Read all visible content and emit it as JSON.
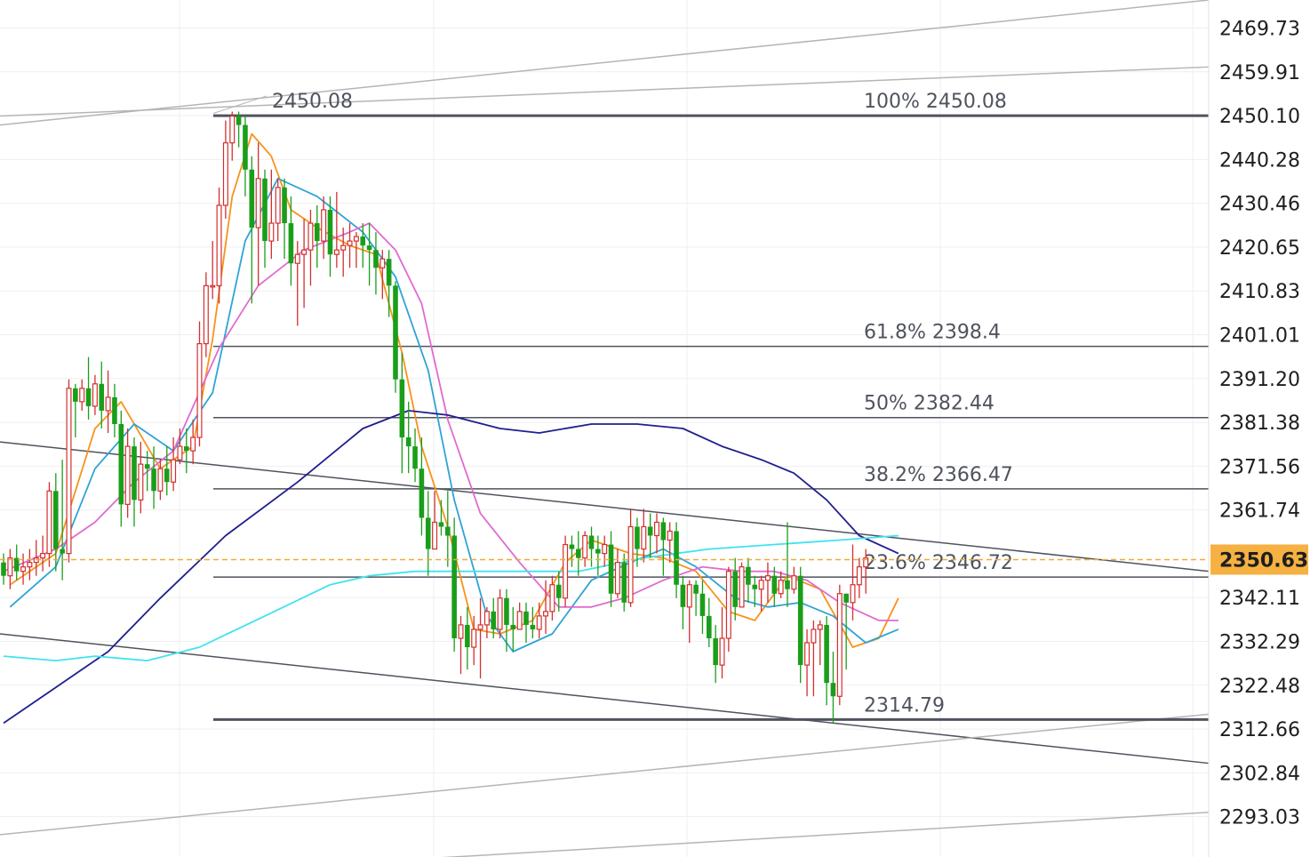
{
  "chart_data": {
    "type": "candlestick",
    "ylim": [
      2284.0,
      2476.0
    ],
    "y_ticks": [
      "2469.73",
      "2459.91",
      "2450.10",
      "2440.28",
      "2430.46",
      "2420.65",
      "2410.83",
      "2401.01",
      "2391.20",
      "2381.38",
      "2371.56",
      "2361.74",
      "2342.11",
      "2332.29",
      "2322.48",
      "2312.66",
      "2302.84",
      "2293.03"
    ],
    "last_price": "2350.63",
    "colors": {
      "up": "#d32f2f",
      "down": "#1a9e1a",
      "fib": "#50535e",
      "ma_orange": "#f7931a",
      "ma_blue": "#2fa4d6",
      "ma_pink": "#e06bd0",
      "ma_navy": "#1f1f8f",
      "ma_cyan": "#3fe3f0",
      "trend": "#50535e",
      "light_trend": "#b5b5b5",
      "current_price": "#f0a93b"
    },
    "fib_levels": [
      {
        "label": "100% 2450.08",
        "price": 2450.08
      },
      {
        "label": "61.8% 2398.4",
        "price": 2398.4
      },
      {
        "label": "50% 2382.44",
        "price": 2382.44
      },
      {
        "label": "38.2% 2366.47",
        "price": 2366.47
      },
      {
        "label": "23.6% 2346.72",
        "price": 2346.72
      },
      {
        "label": "2314.79",
        "price": 2314.79
      }
    ],
    "annotations": [
      {
        "text": "2450.08",
        "price": 2450.08
      }
    ],
    "candles": [
      [
        2350,
        2347,
        2352,
        2345
      ],
      [
        2347,
        2351,
        2353,
        2344
      ],
      [
        2351,
        2348,
        2354,
        2346
      ],
      [
        2348,
        2349,
        2352,
        2345
      ],
      [
        2349,
        2350,
        2353,
        2346
      ],
      [
        2350,
        2351,
        2355,
        2347
      ],
      [
        2351,
        2352,
        2356,
        2348
      ],
      [
        2352,
        2366,
        2368,
        2349
      ],
      [
        2366,
        2353,
        2370,
        2348
      ],
      [
        2353,
        2352,
        2373,
        2346
      ],
      [
        2352,
        2389,
        2391,
        2350
      ],
      [
        2389,
        2386,
        2390,
        2378
      ],
      [
        2386,
        2389,
        2391,
        2384
      ],
      [
        2389,
        2385,
        2396,
        2382
      ],
      [
        2385,
        2390,
        2392,
        2383
      ],
      [
        2390,
        2384,
        2395,
        2380
      ],
      [
        2384,
        2387,
        2393,
        2379
      ],
      [
        2387,
        2381,
        2390,
        2378
      ],
      [
        2381,
        2363,
        2384,
        2358
      ],
      [
        2363,
        2376,
        2380,
        2360
      ],
      [
        2376,
        2364,
        2378,
        2358
      ],
      [
        2364,
        2372,
        2377,
        2361
      ],
      [
        2372,
        2371,
        2375,
        2366
      ],
      [
        2371,
        2366,
        2376,
        2362
      ],
      [
        2366,
        2371,
        2373,
        2364
      ],
      [
        2371,
        2368,
        2376,
        2365
      ],
      [
        2368,
        2373,
        2378,
        2366
      ],
      [
        2373,
        2376,
        2380,
        2372
      ],
      [
        2376,
        2375,
        2380,
        2370
      ],
      [
        2375,
        2378,
        2382,
        2372
      ],
      [
        2378,
        2399,
        2404,
        2376
      ],
      [
        2399,
        2412,
        2415,
        2396
      ],
      [
        2412,
        2412,
        2422,
        2409
      ],
      [
        2412,
        2430,
        2434,
        2408
      ],
      [
        2430,
        2444,
        2449,
        2427
      ],
      [
        2444,
        2450,
        2451,
        2440
      ],
      [
        2450,
        2448,
        2451,
        2443
      ],
      [
        2448,
        2438,
        2450,
        2432
      ],
      [
        2438,
        2425,
        2441,
        2408
      ],
      [
        2425,
        2436,
        2444,
        2412
      ],
      [
        2436,
        2422,
        2438,
        2416
      ],
      [
        2422,
        2426,
        2438,
        2418
      ],
      [
        2426,
        2434,
        2436,
        2422
      ],
      [
        2434,
        2426,
        2436,
        2418
      ],
      [
        2426,
        2417,
        2432,
        2412
      ],
      [
        2417,
        2419,
        2422,
        2403
      ],
      [
        2419,
        2420,
        2427,
        2407
      ],
      [
        2420,
        2426,
        2429,
        2412
      ],
      [
        2426,
        2422,
        2430,
        2416
      ],
      [
        2422,
        2429,
        2432,
        2418
      ],
      [
        2429,
        2419,
        2432,
        2414
      ],
      [
        2419,
        2420,
        2433,
        2416
      ],
      [
        2420,
        2421,
        2425,
        2414
      ],
      [
        2421,
        2422,
        2426,
        2416
      ],
      [
        2422,
        2423,
        2424,
        2416
      ],
      [
        2423,
        2421,
        2426,
        2416
      ],
      [
        2421,
        2420,
        2426,
        2412
      ],
      [
        2420,
        2416,
        2424,
        2410
      ],
      [
        2416,
        2418,
        2420,
        2409
      ],
      [
        2418,
        2412,
        2420,
        2405
      ],
      [
        2412,
        2391,
        2413,
        2388
      ],
      [
        2391,
        2378,
        2397,
        2370
      ],
      [
        2378,
        2376,
        2386,
        2370
      ],
      [
        2376,
        2371,
        2380,
        2368
      ],
      [
        2371,
        2360,
        2378,
        2356
      ],
      [
        2360,
        2353,
        2366,
        2347
      ],
      [
        2353,
        2359,
        2366,
        2356
      ],
      [
        2359,
        2358,
        2364,
        2356
      ],
      [
        2358,
        2356,
        2366,
        2349
      ],
      [
        2356,
        2333,
        2360,
        2330
      ],
      [
        2333,
        2336,
        2338,
        2325
      ],
      [
        2336,
        2331,
        2340,
        2326
      ],
      [
        2331,
        2335,
        2338,
        2327
      ],
      [
        2335,
        2336,
        2342,
        2324
      ],
      [
        2336,
        2339,
        2340,
        2333
      ],
      [
        2339,
        2335,
        2342,
        2333
      ],
      [
        2335,
        2342,
        2344,
        2333
      ],
      [
        2342,
        2336,
        2344,
        2330
      ],
      [
        2336,
        2335,
        2340,
        2330
      ],
      [
        2335,
        2339,
        2341,
        2335
      ],
      [
        2339,
        2336,
        2341,
        2332
      ],
      [
        2336,
        2335,
        2340,
        2333
      ],
      [
        2335,
        2338,
        2341,
        2333
      ],
      [
        2338,
        2339,
        2346,
        2334
      ],
      [
        2339,
        2345,
        2347,
        2337
      ],
      [
        2345,
        2342,
        2348,
        2339
      ],
      [
        2342,
        2354,
        2356,
        2340
      ],
      [
        2354,
        2353,
        2356,
        2349
      ],
      [
        2353,
        2351,
        2357,
        2347
      ],
      [
        2351,
        2356,
        2357,
        2349
      ],
      [
        2356,
        2353,
        2358,
        2349
      ],
      [
        2353,
        2352,
        2356,
        2347
      ],
      [
        2352,
        2354,
        2356,
        2349
      ],
      [
        2354,
        2343,
        2357,
        2340
      ],
      [
        2343,
        2350,
        2353,
        2342
      ],
      [
        2350,
        2341,
        2352,
        2339
      ],
      [
        2341,
        2358,
        2362,
        2340
      ],
      [
        2358,
        2353,
        2360,
        2349
      ],
      [
        2353,
        2358,
        2362,
        2350
      ],
      [
        2358,
        2356,
        2361,
        2351
      ],
      [
        2356,
        2359,
        2361,
        2352
      ],
      [
        2359,
        2355,
        2360,
        2347
      ],
      [
        2355,
        2357,
        2359,
        2350
      ],
      [
        2357,
        2345,
        2359,
        2342
      ],
      [
        2345,
        2340,
        2347,
        2335
      ],
      [
        2340,
        2345,
        2346,
        2332
      ],
      [
        2345,
        2343,
        2346,
        2338
      ],
      [
        2343,
        2338,
        2346,
        2334
      ],
      [
        2338,
        2333,
        2342,
        2331
      ],
      [
        2333,
        2327,
        2336,
        2323
      ],
      [
        2327,
        2333,
        2340,
        2324
      ],
      [
        2333,
        2348,
        2349,
        2330
      ],
      [
        2348,
        2340,
        2351,
        2337
      ],
      [
        2340,
        2349,
        2350,
        2340
      ],
      [
        2349,
        2345,
        2351,
        2341
      ],
      [
        2345,
        2344,
        2347,
        2340
      ],
      [
        2344,
        2346,
        2347,
        2339
      ],
      [
        2346,
        2347,
        2350,
        2341
      ],
      [
        2347,
        2343,
        2349,
        2340
      ],
      [
        2343,
        2346,
        2348,
        2342
      ],
      [
        2346,
        2344,
        2359,
        2340
      ],
      [
        2344,
        2347,
        2349,
        2343
      ],
      [
        2347,
        2327,
        2349,
        2323
      ],
      [
        2327,
        2332,
        2335,
        2320
      ],
      [
        2332,
        2335,
        2337,
        2320
      ],
      [
        2335,
        2336,
        2337,
        2327
      ],
      [
        2336,
        2323,
        2338,
        2318
      ],
      [
        2323,
        2320,
        2330,
        2314
      ],
      [
        2320,
        2343,
        2345,
        2318
      ],
      [
        2343,
        2341,
        2343,
        2326
      ],
      [
        2341,
        2345,
        2354,
        2337
      ],
      [
        2345,
        2349,
        2351,
        2342
      ],
      [
        2349,
        2351,
        2353,
        2343
      ]
    ],
    "moving_averages": [
      {
        "color": "#f7931a",
        "pts": [
          [
            1,
            2345
          ],
          [
            8,
            2352
          ],
          [
            14,
            2380
          ],
          [
            18,
            2386
          ],
          [
            24,
            2371
          ],
          [
            29,
            2376
          ],
          [
            32,
            2400
          ],
          [
            35,
            2432
          ],
          [
            38,
            2446
          ],
          [
            41,
            2441
          ],
          [
            44,
            2429
          ],
          [
            48,
            2425
          ],
          [
            53,
            2421
          ],
          [
            57,
            2419
          ],
          [
            61,
            2397
          ],
          [
            64,
            2376
          ],
          [
            68,
            2358
          ],
          [
            72,
            2335
          ],
          [
            76,
            2334
          ],
          [
            81,
            2337
          ],
          [
            86,
            2350
          ],
          [
            90,
            2355
          ],
          [
            96,
            2352
          ],
          [
            101,
            2351
          ],
          [
            106,
            2348
          ],
          [
            111,
            2339
          ],
          [
            115,
            2337
          ],
          [
            120,
            2347
          ],
          [
            125,
            2344
          ],
          [
            130,
            2331
          ],
          [
            134,
            2333
          ],
          [
            137,
            2342
          ]
        ]
      },
      {
        "color": "#2fa4d6",
        "pts": [
          [
            1,
            2340
          ],
          [
            8,
            2349
          ],
          [
            14,
            2371
          ],
          [
            20,
            2381
          ],
          [
            26,
            2375
          ],
          [
            32,
            2388
          ],
          [
            37,
            2422
          ],
          [
            42,
            2436
          ],
          [
            48,
            2432
          ],
          [
            55,
            2424
          ],
          [
            60,
            2414
          ],
          [
            65,
            2393
          ],
          [
            69,
            2364
          ],
          [
            74,
            2338
          ],
          [
            78,
            2330
          ],
          [
            84,
            2334
          ],
          [
            90,
            2346
          ],
          [
            96,
            2350
          ],
          [
            101,
            2353
          ],
          [
            106,
            2349
          ],
          [
            112,
            2342
          ],
          [
            117,
            2340
          ],
          [
            122,
            2341
          ],
          [
            127,
            2338
          ],
          [
            132,
            2332
          ],
          [
            137,
            2335
          ]
        ]
      },
      {
        "color": "#e06bd0",
        "pts": [
          [
            0,
            2348
          ],
          [
            8,
            2353
          ],
          [
            14,
            2359
          ],
          [
            20,
            2368
          ],
          [
            26,
            2375
          ],
          [
            33,
            2398
          ],
          [
            39,
            2412
          ],
          [
            46,
            2420
          ],
          [
            53,
            2424
          ],
          [
            56,
            2426
          ],
          [
            60,
            2420
          ],
          [
            64,
            2408
          ],
          [
            68,
            2382
          ],
          [
            73,
            2361
          ],
          [
            79,
            2350
          ],
          [
            85,
            2340
          ],
          [
            90,
            2340
          ],
          [
            95,
            2342
          ],
          [
            101,
            2346
          ],
          [
            107,
            2349
          ],
          [
            113,
            2348
          ],
          [
            118,
            2348
          ],
          [
            123,
            2346
          ],
          [
            128,
            2341
          ],
          [
            134,
            2337
          ],
          [
            137,
            2337
          ]
        ]
      },
      {
        "color": "#1f1f8f",
        "pts": [
          [
            0,
            2314
          ],
          [
            8,
            2322
          ],
          [
            16,
            2330
          ],
          [
            24,
            2342
          ],
          [
            34,
            2356
          ],
          [
            45,
            2368
          ],
          [
            55,
            2380
          ],
          [
            62,
            2384
          ],
          [
            68,
            2383
          ],
          [
            76,
            2380
          ],
          [
            82,
            2379
          ],
          [
            90,
            2381
          ],
          [
            97,
            2381
          ],
          [
            104,
            2380
          ],
          [
            110,
            2376
          ],
          [
            116,
            2373
          ],
          [
            121,
            2370
          ],
          [
            126,
            2364
          ],
          [
            131,
            2356
          ],
          [
            137,
            2352
          ]
        ]
      },
      {
        "color": "#3fe3f0",
        "pts": [
          [
            0,
            2329
          ],
          [
            8,
            2328
          ],
          [
            14,
            2329
          ],
          [
            22,
            2328
          ],
          [
            30,
            2331
          ],
          [
            40,
            2338
          ],
          [
            50,
            2345
          ],
          [
            56,
            2347
          ],
          [
            63,
            2348
          ],
          [
            68,
            2348
          ],
          [
            78,
            2348
          ],
          [
            88,
            2348
          ],
          [
            98,
            2351
          ],
          [
            108,
            2353
          ],
          [
            118,
            2354
          ],
          [
            128,
            2355
          ],
          [
            137,
            2356
          ]
        ]
      }
    ]
  }
}
